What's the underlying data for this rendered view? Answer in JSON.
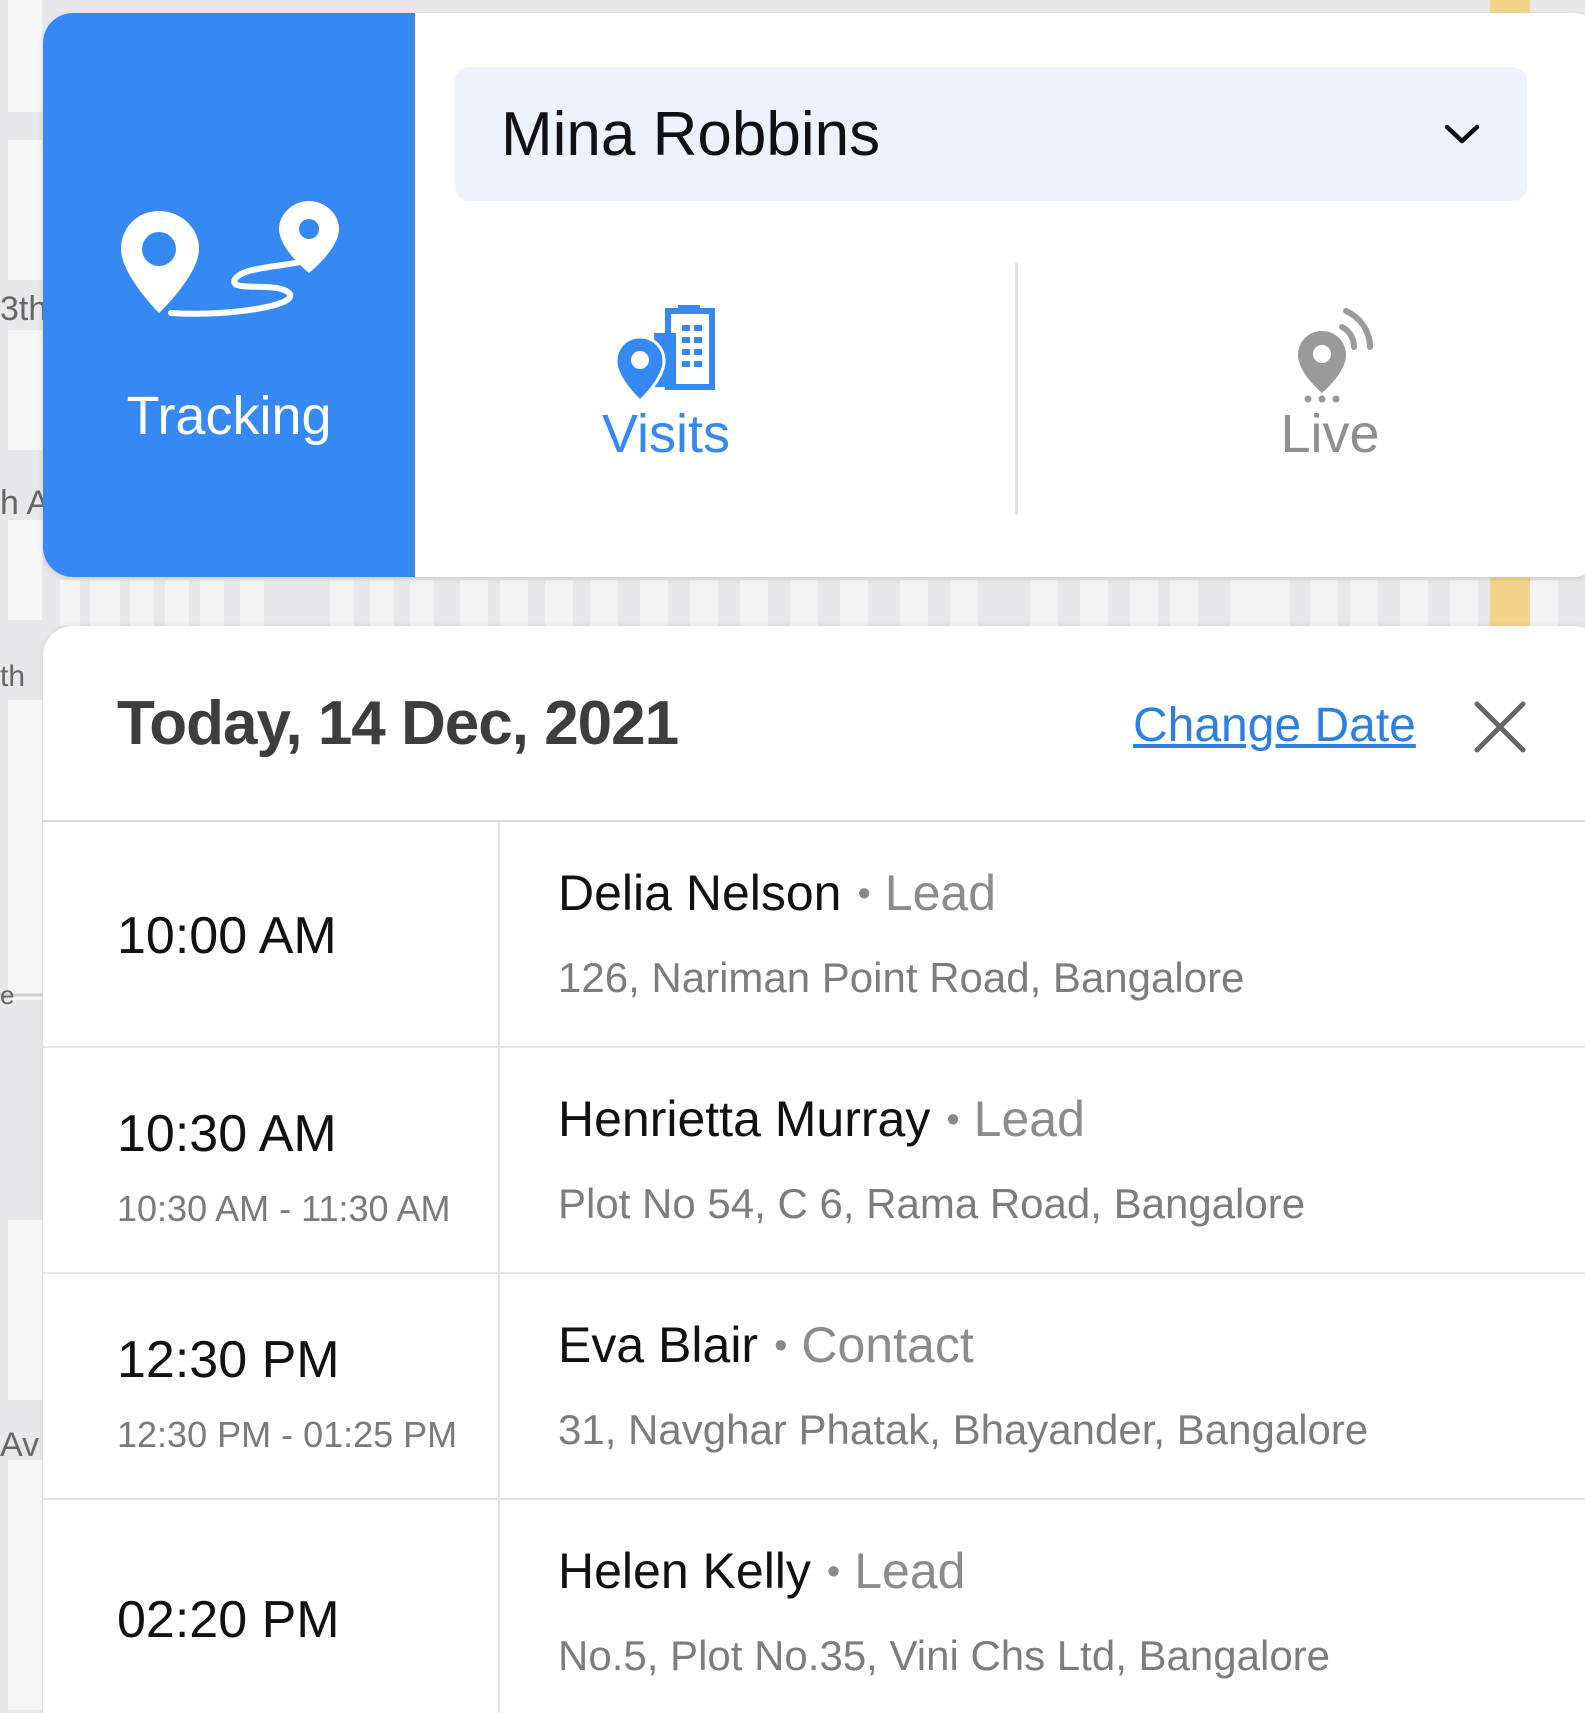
{
  "header": {
    "tracking_label": "Tracking",
    "selected_user": "Mina Robbins",
    "tabs": [
      {
        "label": "Visits",
        "icon": "building-pin-icon",
        "active": true
      },
      {
        "label": "Live",
        "icon": "live-pin-icon",
        "active": false
      }
    ]
  },
  "map_labels": [
    "3th",
    "h A",
    "th",
    "e",
    "Av"
  ],
  "panel": {
    "date_title": "Today, 14 Dec, 2021",
    "change_date_label": "Change Date",
    "visits": [
      {
        "time": "10:00 AM",
        "range": "",
        "name": "Delia Nelson",
        "type": "Lead",
        "address": "126, Nariman Point Road, Bangalore"
      },
      {
        "time": "10:30 AM",
        "range": "10:30 AM - 11:30 AM",
        "name": "Henrietta Murray",
        "type": "Lead",
        "address": "Plot No 54, C 6, Rama Road, Bangalore"
      },
      {
        "time": "12:30 PM",
        "range": "12:30 PM - 01:25 PM",
        "name": "Eva Blair",
        "type": "Contact",
        "address": "31, Navghar Phatak, Bhayander, Bangalore"
      },
      {
        "time": "02:20 PM",
        "range": "",
        "name": "Helen Kelly",
        "type": "Lead",
        "address": "No.5, Plot No.35, Vini Chs Ltd, Bangalore"
      }
    ]
  },
  "colors": {
    "accent": "#3688f2",
    "link": "#2c7fe3",
    "muted": "#8c8c8c"
  }
}
